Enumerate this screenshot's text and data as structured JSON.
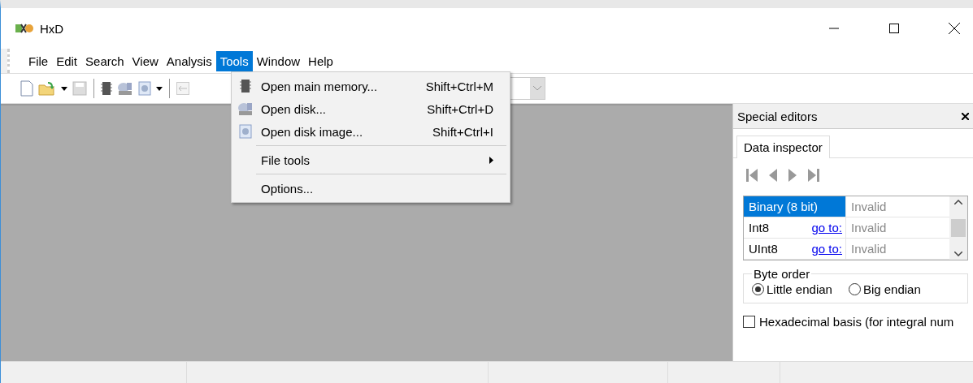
{
  "window": {
    "title": "HxD"
  },
  "menu_bar": [
    {
      "label": "File",
      "selected": false
    },
    {
      "label": "Edit",
      "selected": false
    },
    {
      "label": "Search",
      "selected": false
    },
    {
      "label": "View",
      "selected": false
    },
    {
      "label": "Analysis",
      "selected": false
    },
    {
      "label": "Tools",
      "selected": true
    },
    {
      "label": "Window",
      "selected": false
    },
    {
      "label": "Help",
      "selected": false
    }
  ],
  "tools_menu": {
    "items": [
      {
        "kind": "command",
        "label": "Open main memory...",
        "shortcut": "Shift+Ctrl+M"
      },
      {
        "kind": "command",
        "label": "Open disk...",
        "shortcut": "Shift+Ctrl+D"
      },
      {
        "kind": "command",
        "label": "Open disk image...",
        "shortcut": "Shift+Ctrl+I"
      },
      {
        "kind": "separator"
      },
      {
        "kind": "submenu",
        "label": "File tools"
      },
      {
        "kind": "separator"
      },
      {
        "kind": "command",
        "label": "Options..."
      }
    ]
  },
  "special_editors": {
    "title": "Special editors",
    "tabs": [
      {
        "label": "Data inspector",
        "selected": true
      }
    ],
    "rows": [
      {
        "type": "Binary (8 bit)",
        "value": "Invalid",
        "selected": true
      },
      {
        "type": "Int8",
        "link": "go to:",
        "value": "Invalid",
        "selected": false
      },
      {
        "type": "UInt8",
        "link": "go to:",
        "value": "Invalid",
        "selected": false
      }
    ],
    "byte_order": {
      "label": "Byte order",
      "options": [
        {
          "label": "Little endian",
          "selected": true
        },
        {
          "label": "Big endian",
          "selected": false
        }
      ]
    },
    "hex_basis": {
      "label": "Hexadecimal basis (for integral num",
      "checked": false
    }
  }
}
